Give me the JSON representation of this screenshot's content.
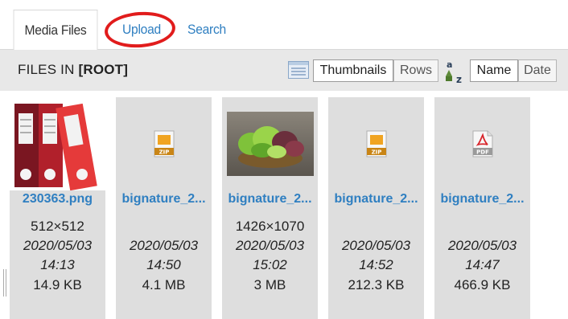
{
  "tabs": {
    "media_files": "Media Files",
    "upload": "Upload",
    "search": "Search"
  },
  "toolbar": {
    "title_prefix": "FILES IN ",
    "folder": "[ROOT]",
    "view_modes": {
      "thumbnails": "Thumbnails",
      "rows": "Rows",
      "active": "Thumbnails"
    },
    "sort_modes": {
      "name": "Name",
      "date": "Date",
      "active": "Name"
    },
    "sort_icon_letters": {
      "top": "a",
      "bottom": "z"
    }
  },
  "files": [
    {
      "name": "230363.png",
      "dimensions": "512×512",
      "date": "2020/05/03",
      "time": "14:13",
      "size": "14.9 KB",
      "thumb": "binders-image"
    },
    {
      "name": "bignature_2...",
      "dimensions": "",
      "date": "2020/05/03",
      "time": "14:50",
      "size": "4.1 MB",
      "thumb": "zip-icon",
      "badge": "ZIP"
    },
    {
      "name": "bignature_2...",
      "dimensions": "1426×1070",
      "date": "2020/05/03",
      "time": "15:02",
      "size": "3 MB",
      "thumb": "lettuce-image"
    },
    {
      "name": "bignature_2...",
      "dimensions": "",
      "date": "2020/05/03",
      "time": "14:52",
      "size": "212.3 KB",
      "thumb": "zip-icon",
      "badge": "ZIP"
    },
    {
      "name": "bignature_2...",
      "dimensions": "",
      "date": "2020/05/03",
      "time": "14:47",
      "size": "466.9 KB",
      "thumb": "pdf-icon",
      "badge": "PDF"
    }
  ],
  "colors": {
    "link": "#2f7fc1",
    "highlight_ring": "#e11c1c",
    "card_bg": "#dedede",
    "toolbar_bg": "#e8e8e8"
  }
}
